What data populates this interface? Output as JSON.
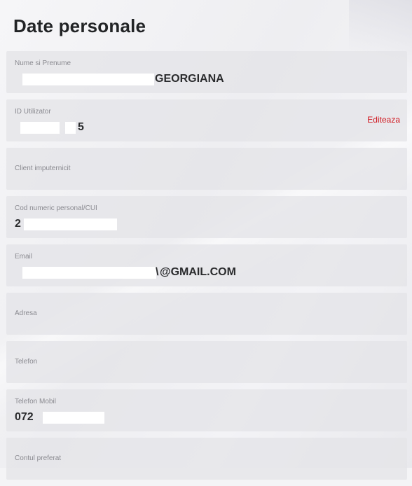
{
  "page": {
    "title": "Date personale"
  },
  "fields": {
    "name": {
      "label": "Nume si Prenume",
      "value": "GEORGIANA"
    },
    "user_id": {
      "label": "ID Utilizator",
      "value": "5",
      "edit_label": "Editeaza"
    },
    "authorized_client": {
      "label": "Client imputernicit"
    },
    "cnp": {
      "label": "Cod numeric personal/CUI",
      "value": "2"
    },
    "email": {
      "label": "Email",
      "value": "@GMAIL.COM"
    },
    "address": {
      "label": "Adresa"
    },
    "phone": {
      "label": "Telefon"
    },
    "mobile": {
      "label": "Telefon Mobil",
      "value": "072"
    },
    "preferred_account": {
      "label": "Contul preferat"
    }
  },
  "colors": {
    "edit_link": "#d0161e",
    "title": "#222426",
    "label": "#8a8a90",
    "field_bg": "#e4e4e8",
    "redaction": "#ffffff"
  }
}
